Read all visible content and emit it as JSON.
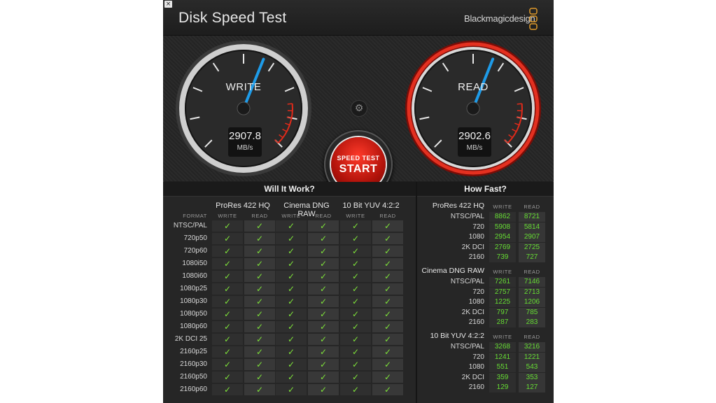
{
  "app": {
    "title": "Disk Speed Test",
    "brand": "Blackmagicdesign",
    "close": "×"
  },
  "gauges": {
    "write": {
      "label": "WRITE",
      "value": "2907.8",
      "unit": "MB/s"
    },
    "read": {
      "label": "READ",
      "value": "2902.6",
      "unit": "MB/s"
    }
  },
  "start": {
    "line1": "SPEED TEST",
    "line2": "START",
    "settings_glyph": "⚙"
  },
  "will_it_work": {
    "header": "Will It Work?",
    "format_label": "FORMAT",
    "write_label": "WRITE",
    "read_label": "READ",
    "groups": [
      "ProRes 422 HQ",
      "Cinema DNG RAW",
      "10 Bit YUV 4:2:2"
    ],
    "check": "✓",
    "formats": [
      "NTSC/PAL",
      "720p50",
      "720p60",
      "1080i50",
      "1080i60",
      "1080p25",
      "1080p30",
      "1080p50",
      "1080p60",
      "2K DCI 25",
      "2160p25",
      "2160p30",
      "2160p50",
      "2160p60"
    ]
  },
  "how_fast": {
    "header": "How Fast?",
    "write_label": "WRITE",
    "read_label": "READ",
    "groups": [
      {
        "name": "ProRes 422 HQ",
        "rows": [
          {
            "fmt": "NTSC/PAL",
            "w": "8862",
            "r": "8721"
          },
          {
            "fmt": "720",
            "w": "5908",
            "r": "5814"
          },
          {
            "fmt": "1080",
            "w": "2954",
            "r": "2907"
          },
          {
            "fmt": "2K DCI",
            "w": "2769",
            "r": "2725"
          },
          {
            "fmt": "2160",
            "w": "739",
            "r": "727"
          }
        ]
      },
      {
        "name": "Cinema DNG RAW",
        "rows": [
          {
            "fmt": "NTSC/PAL",
            "w": "7261",
            "r": "7146"
          },
          {
            "fmt": "720",
            "w": "2757",
            "r": "2713"
          },
          {
            "fmt": "1080",
            "w": "1225",
            "r": "1206"
          },
          {
            "fmt": "2K DCI",
            "w": "797",
            "r": "785"
          },
          {
            "fmt": "2160",
            "w": "287",
            "r": "283"
          }
        ]
      },
      {
        "name": "10 Bit YUV 4:2:2",
        "rows": [
          {
            "fmt": "NTSC/PAL",
            "w": "3268",
            "r": "3216"
          },
          {
            "fmt": "720",
            "w": "1241",
            "r": "1221"
          },
          {
            "fmt": "1080",
            "w": "551",
            "r": "543"
          },
          {
            "fmt": "2K DCI",
            "w": "359",
            "r": "353"
          },
          {
            "fmt": "2160",
            "w": "129",
            "r": "127"
          }
        ]
      }
    ]
  },
  "colors": {
    "accent_red": "#c0140a",
    "needle_blue": "#1e9be8",
    "ok_green": "#7ee23a"
  }
}
